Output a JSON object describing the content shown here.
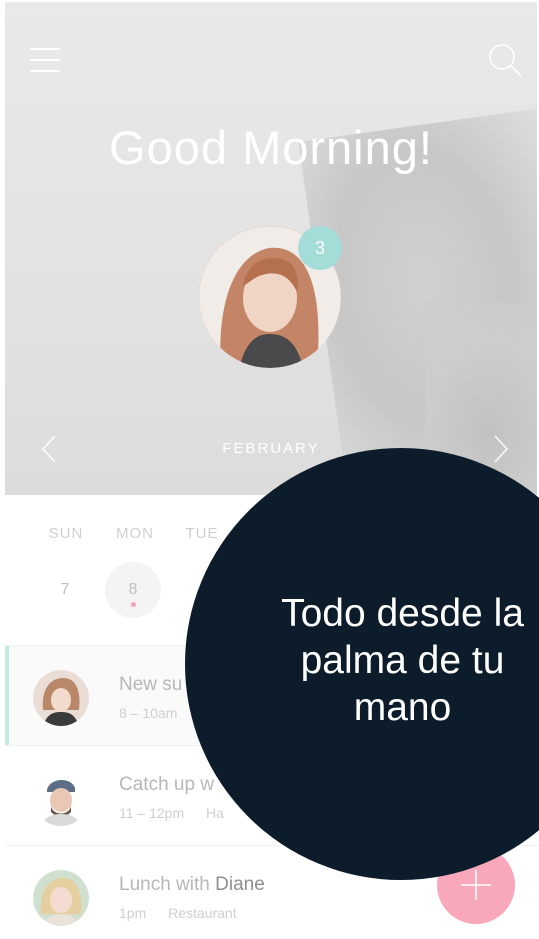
{
  "header": {
    "greeting": "Good Morning!",
    "notification_count": "3",
    "month": "FEBRUARY"
  },
  "week": {
    "days": [
      "SUN",
      "MON",
      "TUE"
    ],
    "dates": [
      "7",
      "8"
    ]
  },
  "events": [
    {
      "title_prefix": "New su",
      "title_name": "",
      "time": "8 – 10am",
      "place": ""
    },
    {
      "title_prefix": "Catch up w",
      "title_name": "",
      "time": "11 – 12pm",
      "place": "Ha"
    },
    {
      "title_prefix": "Lunch with ",
      "title_name": "Diane",
      "time": "1pm",
      "place": "Restaurant"
    }
  ],
  "overlay": {
    "line1": "Todo desde la",
    "line2": "palma de tu",
    "line3": "mano"
  },
  "colors": {
    "overlay": "#0d1c2b",
    "badge": "#a4ddd8",
    "fab": "#f9a7ba",
    "accent_bar": "#bfe9e3"
  },
  "icons": [
    "menu-icon",
    "search-icon",
    "chevron-left-icon",
    "chevron-right-icon",
    "plus-icon"
  ]
}
